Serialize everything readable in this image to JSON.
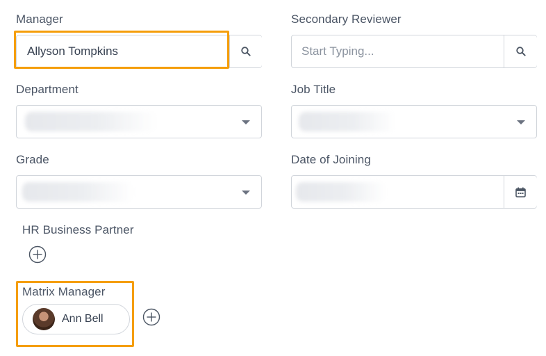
{
  "form": {
    "manager": {
      "label": "Manager",
      "value": "Allyson Tompkins"
    },
    "secondary_reviewer": {
      "label": "Secondary Reviewer",
      "placeholder": "Start Typing..."
    },
    "department": {
      "label": "Department"
    },
    "job_title": {
      "label": "Job Title"
    },
    "grade": {
      "label": "Grade"
    },
    "date_of_joining": {
      "label": "Date of Joining"
    },
    "hr_business_partner": {
      "label": "HR Business Partner"
    },
    "matrix_manager": {
      "label": "Matrix Manager",
      "people": [
        {
          "name": "Ann Bell"
        }
      ]
    }
  },
  "icons": {
    "search": "search-icon",
    "caret": "caret-down-icon",
    "calendar": "calendar-icon",
    "add": "plus-circle-icon"
  },
  "colors": {
    "highlight": "#f59e0b",
    "border": "#d1d5db",
    "label": "#4b5565"
  }
}
